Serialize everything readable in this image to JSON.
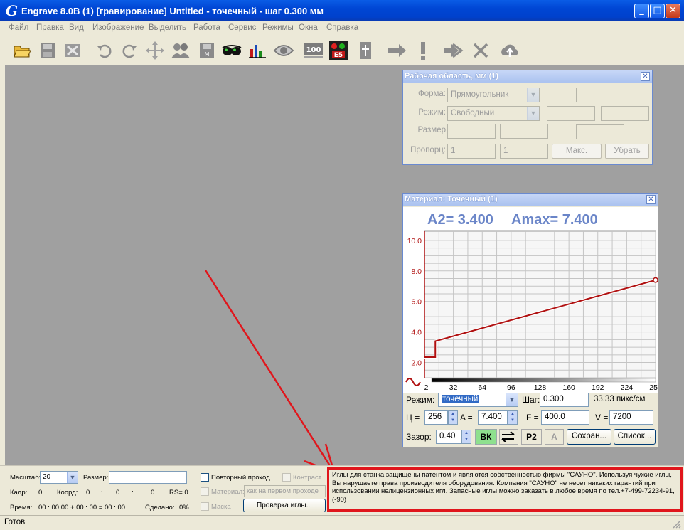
{
  "window": {
    "app_letter": "G",
    "title": "Engrave 8.0B (1) [гравирование] Untitled - точечный - шаг 0.300 мм",
    "buttons": [
      "minimize-icon",
      "maximize-icon",
      "close-icon"
    ]
  },
  "menu": [
    "Файл",
    "Правка",
    "Вид",
    "Изображение",
    "Выделить",
    "Работа",
    "Сервис",
    "Режимы",
    "Окна",
    "Справка"
  ],
  "toolbar": {
    "icons": [
      "open-folder-icon",
      "save-icon",
      "close-doc-icon",
      "undo-icon",
      "redo-icon",
      "move-icon",
      "people-icon",
      "save-as-icon",
      "glasses-icon",
      "bar-chart-icon",
      "eye-icon",
      "100-icon",
      "stop-icon",
      "figure-icon",
      "arrow-right-icon",
      "exclamation-icon",
      "arrow-right-2-icon",
      "cancel-x-icon",
      "cloud-upload-icon"
    ],
    "label_100": "100",
    "label_stop": "E5"
  },
  "workarea_panel": {
    "title": "Рабочая область, мм (1)",
    "shape_label": "Форма:",
    "shape_value": "Прямоугольник",
    "mode_label": "Режим:",
    "mode_value": "Свободный",
    "size_label": "Размер",
    "prop_label": "Пропорц:",
    "prop_value_1": "1",
    "prop_value_2": "1",
    "max_button": "Макс.",
    "remove_button": "Убрать"
  },
  "material_panel": {
    "title": "Материал: Точечный (1)",
    "readout_a2": "A2=  3.400",
    "readout_amax": "Amax=  7.400",
    "mode_label": "Режим:",
    "mode_value": "точечный",
    "step_label": "Шаг:",
    "step_value": "0.300",
    "resolution": "33.33 пикс/см",
    "c_label": "Ц =",
    "c_value": "256",
    "a_label": "A =",
    "a_value": "7.400",
    "f_label": "F =",
    "f_value": "400.0",
    "v_label": "V =",
    "v_value": "7200",
    "gap_label": "Зазор:",
    "gap_value": "0.40",
    "vk_button": "ВК",
    "p2_button": "P2",
    "a_button": "A",
    "save_button": "Сохран...",
    "list_button": "Список..."
  },
  "chart_data": {
    "type": "line",
    "title": "",
    "xlabel": "",
    "ylabel": "",
    "x_ticks": [
      2,
      32,
      64,
      96,
      128,
      160,
      192,
      224,
      256
    ],
    "y_ticks": [
      "2.0",
      "4.0",
      "6.0",
      "8.0",
      "10.0"
    ],
    "xlim": [
      0,
      256
    ],
    "ylim": [
      1.0,
      10.6
    ],
    "grid": true,
    "series": [
      {
        "x": [
          0,
          12,
          12,
          256
        ],
        "y": [
          2.35,
          2.35,
          3.4,
          7.4
        ],
        "color": "#b01010"
      }
    ]
  },
  "bottom": {
    "scale_label": "Масштаб:",
    "scale_value": "20",
    "size_label": "Размер:",
    "size_value": "",
    "repeat_pass": "Повторный проход",
    "contrast": "Контраст",
    "frame_label": "Кадр:",
    "frame_value": "0",
    "coord_label": "Коорд:",
    "coord_values": [
      "0",
      ":",
      "0",
      ":",
      "0"
    ],
    "rs_label": "RS= 0",
    "material_label": "Материал:",
    "material_value": "как на первом проходе",
    "time_label": "Время:",
    "time_value": "00 : 00  00 + 00 : 00 =  00 : 00",
    "done_label": "Сделано:",
    "done_value": "0%",
    "mask_label": "Маска",
    "check_needle_button": "Проверка иглы..."
  },
  "notice": {
    "text": "Иглы для станка защищены патентом и являются собственностью фирмы \"САУНО\". Используя чужие иглы, Вы нарушаете права производителя оборудования. Компания \"САУНО\" не несет никаких гарантий при использовании нелицензионных игл. Запасные иглы можно заказать в любое время по тел.+7-499-72234-91, (-90)",
    "border_color": "#e0161c"
  },
  "status": {
    "text": "Готов"
  }
}
